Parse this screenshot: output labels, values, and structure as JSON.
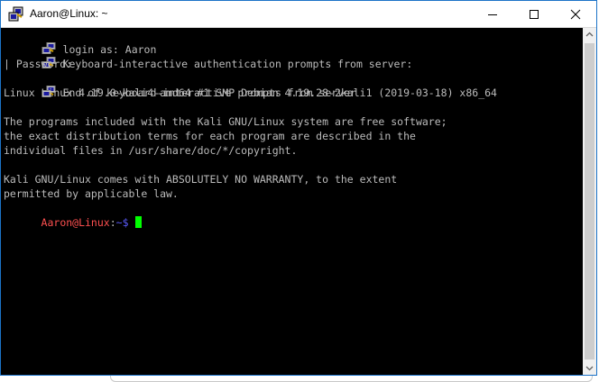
{
  "window": {
    "title": "Aaron@Linux: ~",
    "app_icon": "putty-icon",
    "controls": [
      "minimize-icon",
      "maximize-icon",
      "close-icon"
    ]
  },
  "terminal": {
    "lines": [
      {
        "icon": "putty-icon",
        "text": "login as: Aaron"
      },
      {
        "icon": "putty-icon",
        "text": "Keyboard-interactive authentication prompts from server:"
      },
      {
        "icon": null,
        "text": "| Password:"
      },
      {
        "icon": "putty-icon",
        "text": "End of keyboard-interactive prompts from server"
      },
      {
        "icon": null,
        "text": "Linux Linux 4.19.0-kali4-amd64 #1 SMP Debian 4.19.28-2kali1 (2019-03-18) x86_64"
      },
      {
        "icon": null,
        "text": ""
      },
      {
        "icon": null,
        "text": "The programs included with the Kali GNU/Linux system are free software;"
      },
      {
        "icon": null,
        "text": "the exact distribution terms for each program are described in the"
      },
      {
        "icon": null,
        "text": "individual files in /usr/share/doc/*/copyright."
      },
      {
        "icon": null,
        "text": ""
      },
      {
        "icon": null,
        "text": "Kali GNU/Linux comes with ABSOLUTELY NO WARRANTY, to the extent"
      },
      {
        "icon": null,
        "text": "permitted by applicable law."
      }
    ],
    "prompt": {
      "user_host": "Aaron@Linux",
      "separator": ":",
      "path": "~$",
      "user_color": "#ff5050",
      "path_color": "#5c5cff"
    },
    "cursor_color": "#00ff00",
    "background": "#000000",
    "foreground": "#bbbbbb"
  },
  "scrollbar": {
    "icons": [
      "scroll-up-arrow-icon",
      "scroll-down-arrow-icon"
    ]
  }
}
